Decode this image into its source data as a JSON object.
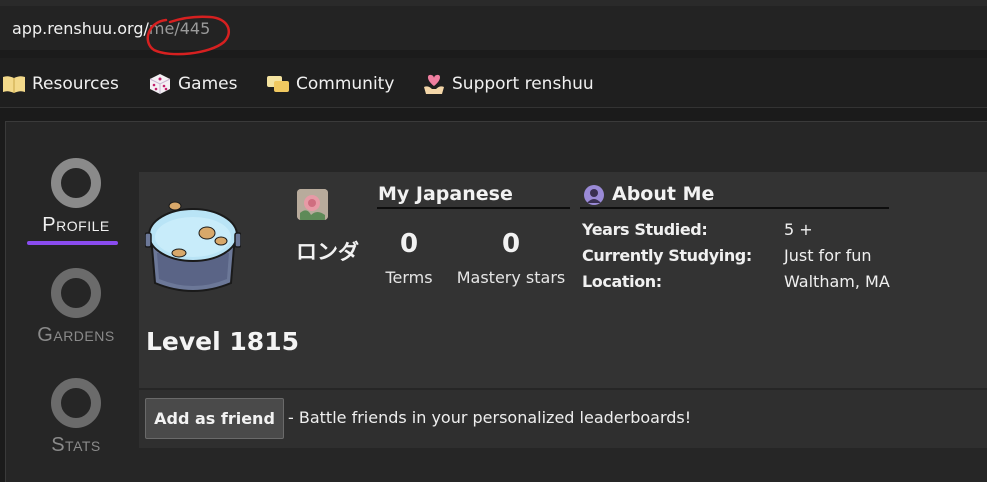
{
  "browser": {
    "url_host": "app.renshuu.org/",
    "url_path": "me/445"
  },
  "nav": {
    "items": [
      {
        "label": "Resources",
        "icon": "book-icon"
      },
      {
        "label": "Games",
        "icon": "dice-icon"
      },
      {
        "label": "Community",
        "icon": "chat-bubbles-icon"
      },
      {
        "label": "Support renshuu",
        "icon": "heart-hands-icon"
      }
    ]
  },
  "sidebar": {
    "items": [
      {
        "label": "Profile",
        "icon": "ring-icon",
        "active": true
      },
      {
        "label": "Gardens",
        "icon": "ring-icon",
        "active": false
      },
      {
        "label": "Stats",
        "icon": "ring-icon",
        "active": false
      }
    ],
    "accent": "#8a4cf0"
  },
  "profile": {
    "level": "Level 1815",
    "username": "ロンダ",
    "avatar_icon": "pot-with-snails-icon"
  },
  "my_japanese": {
    "title": "My Japanese",
    "terms_value": "0",
    "terms_label": "Terms",
    "mastery_value": "0",
    "mastery_label": "Mastery stars"
  },
  "about_me": {
    "title": "About Me",
    "rows": [
      {
        "key": "Years Studied:",
        "value": "5 +"
      },
      {
        "key": "Currently Studying:",
        "value": "Just for fun"
      },
      {
        "key": "Location:",
        "value": "Waltham, MA"
      }
    ]
  },
  "friend": {
    "button_label": "Add as friend",
    "description": "- Battle friends in your personalized leaderboards!"
  }
}
